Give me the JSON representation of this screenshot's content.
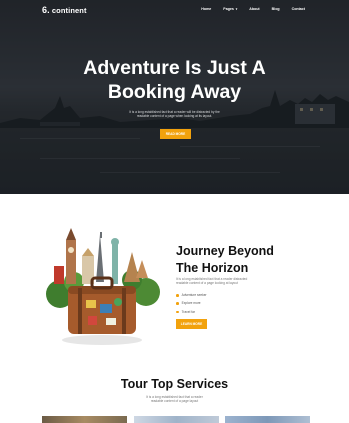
{
  "brand": {
    "logo_mark": "6.",
    "logo_text": "continent"
  },
  "nav": {
    "items": [
      "Home",
      "Pages",
      "About",
      "Blog",
      "Contact"
    ]
  },
  "hero": {
    "title_line1": "Adventure Is Just A",
    "title_line2": "Booking Away",
    "subtitle": "It is a long established fact that a reader will be distracted by the readable content of a page when looking at its layout.",
    "button": "READ MORE"
  },
  "journey": {
    "title_line1": "Journey Beyond",
    "title_line2": "The Horizon",
    "text": "It is a long established fact that a reader distracted readable content of a page looking at layout",
    "list": [
      "Adventure seeker",
      "Explore more",
      "Travel far"
    ],
    "button": "LEARN MORE"
  },
  "services": {
    "title": "Tour Top Services",
    "text": "It is a long established fact that a reader readable content of a page layout"
  },
  "colors": {
    "accent": "#f2a20d",
    "hero_bg": "#2a2e33",
    "page_bg": "#ffffff"
  }
}
